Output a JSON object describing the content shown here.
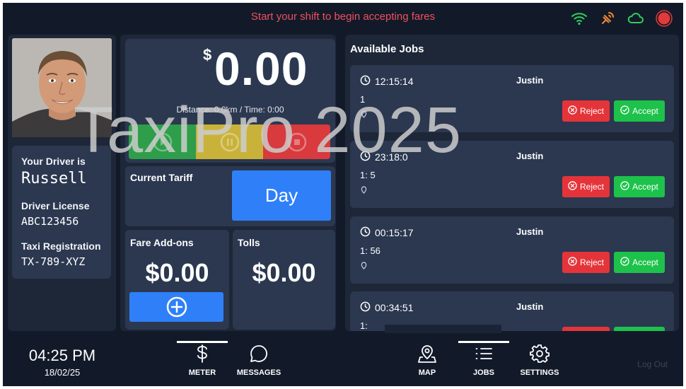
{
  "banner": "Start your shift to begin accepting fares",
  "status_icons": [
    "wifi-icon",
    "gps-signal-icon",
    "cloud-icon",
    "record-icon"
  ],
  "colors": {
    "background": "#121a2a",
    "panel": "#1d2738",
    "card": "#2b3850",
    "accent_blue": "#2f80f8",
    "reject_red": "#e4343a",
    "accept_green": "#1dc24b",
    "banner_red": "#f0505a"
  },
  "driver": {
    "intro_label": "Your Driver is",
    "name": "Russell",
    "license_label": "Driver License",
    "license": "ABC123456",
    "registration_label": "Taxi Registration",
    "registration": "TX-789-XYZ"
  },
  "meter": {
    "currency_symbol": "$",
    "fare": "0.00",
    "distance_time": "Distance: 0.0km / Time: 0:00",
    "controls": [
      "play-icon",
      "pause-icon",
      "stop-icon"
    ]
  },
  "tariff": {
    "label": "Current Tariff",
    "value": "Day"
  },
  "addons": {
    "label": "Fare Add-ons",
    "amount": "$0.00"
  },
  "tolls": {
    "label": "Tolls",
    "amount": "$0.00"
  },
  "jobs": {
    "title": "Available Jobs",
    "reject_label": "Reject",
    "accept_label": "Accept",
    "items": [
      {
        "time": "12:15:14",
        "name": "Justin",
        "address": "1"
      },
      {
        "time": "23:18:0",
        "name": "Justin",
        "address": "1: 5"
      },
      {
        "time": "00:15:17",
        "name": "Justin",
        "address": "1: 56"
      },
      {
        "time": "00:34:51",
        "name": "Justin",
        "address": "1:"
      }
    ]
  },
  "footer": {
    "time": "04:25 PM",
    "date": "18/02/25",
    "nav": [
      {
        "label": "METER",
        "icon": "dollar-icon",
        "active": true
      },
      {
        "label": "MESSAGES",
        "icon": "message-icon",
        "active": false
      },
      {
        "label": "MAP",
        "icon": "map-pin-icon",
        "active": false
      },
      {
        "label": "JOBS",
        "icon": "list-icon",
        "active": true
      },
      {
        "label": "SETTINGS",
        "icon": "gear-icon",
        "active": false
      }
    ],
    "logout": "Log Out"
  },
  "watermark": "TaxiPro 2025"
}
